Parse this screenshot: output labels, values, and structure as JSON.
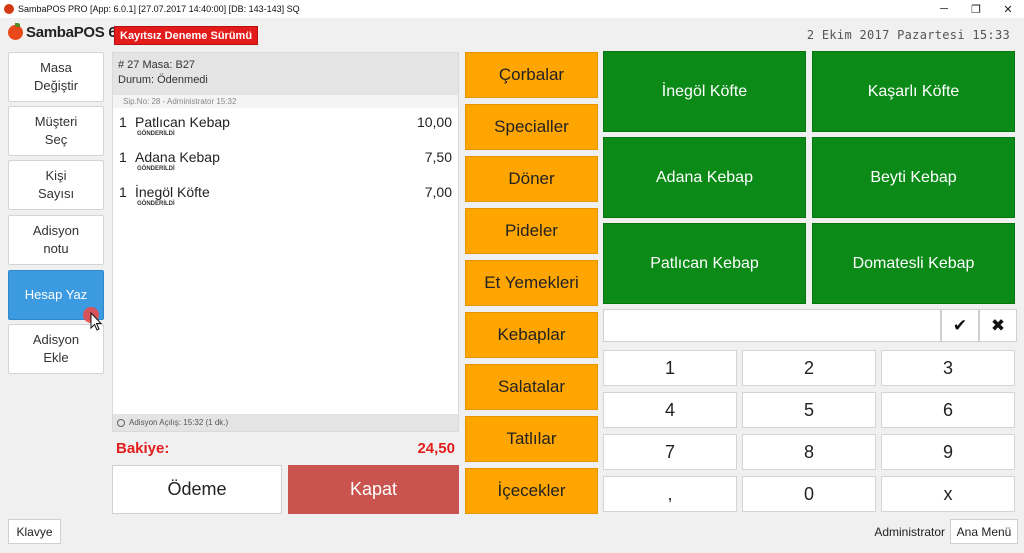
{
  "window": {
    "title": "SambaPOS PRO [App: 6.0.1] [27.07.2017 14:40:00] [DB: 143-143] SQ",
    "controls": [
      "─",
      "❐",
      "✕"
    ]
  },
  "header": {
    "logo_text": "SambaPOS 6",
    "trial_badge": "Kayıtsız Deneme Sürümü",
    "datetime": "2 Ekim 2017 Pazartesi 15:33"
  },
  "left_buttons": [
    {
      "label": "Masa\nDeğiştir"
    },
    {
      "label": "Müşteri\nSeç"
    },
    {
      "label": "Kişi\nSayısı"
    },
    {
      "label": "Adisyon\nnotu"
    },
    {
      "label": "Hesap Yaz",
      "active": true
    },
    {
      "label": "Adisyon\nEkle"
    }
  ],
  "ticket": {
    "line1": "# 27 Masa: B27",
    "line2": "Durum: Ödenmedi",
    "sub_info": "Sip.No: 28 - Administrator 15:32",
    "orders": [
      {
        "qty": "1",
        "name": "Patlıcan Kebap",
        "status": "GÖNDERİLDİ",
        "price": "10,00"
      },
      {
        "qty": "1",
        "name": "Adana Kebap",
        "status": "GÖNDERİLDİ",
        "price": "7,50"
      },
      {
        "qty": "1",
        "name": "İnegöl Köfte",
        "status": "GÖNDERİLDİ",
        "price": "7,00"
      }
    ],
    "footer": "Adisyon Açılış: 15:32 (1 dk.)"
  },
  "balance": {
    "label": "Bakiye:",
    "value": "24,50"
  },
  "actions": {
    "pay": "Ödeme",
    "close": "Kapat"
  },
  "categories": [
    "Çorbalar",
    "Specialler",
    "Döner",
    "Pideler",
    "Et Yemekleri",
    "Kebaplar",
    "Salatalar",
    "Tatlılar",
    "İçecekler"
  ],
  "products": [
    "İnegöl Köfte",
    "Kaşarlı Köfte",
    "Adana Kebap",
    "Beyti Kebap",
    "Patlıcan Kebap",
    "Domatesli Kebap"
  ],
  "numpad": {
    "input_value": "",
    "ok": "✔",
    "cancel": "✖",
    "keys": [
      "1",
      "2",
      "3",
      "4",
      "5",
      "6",
      "7",
      "8",
      "9",
      ",",
      "0",
      "x"
    ]
  },
  "footer": {
    "keyboard": "Klavye",
    "user": "Administrator",
    "main_menu": "Ana Menü"
  },
  "colors": {
    "category": "#ffa500",
    "product": "#0b8a17",
    "close_button": "#c9534f",
    "active_button": "#3c9ae0",
    "balance": "#e21d1d"
  }
}
